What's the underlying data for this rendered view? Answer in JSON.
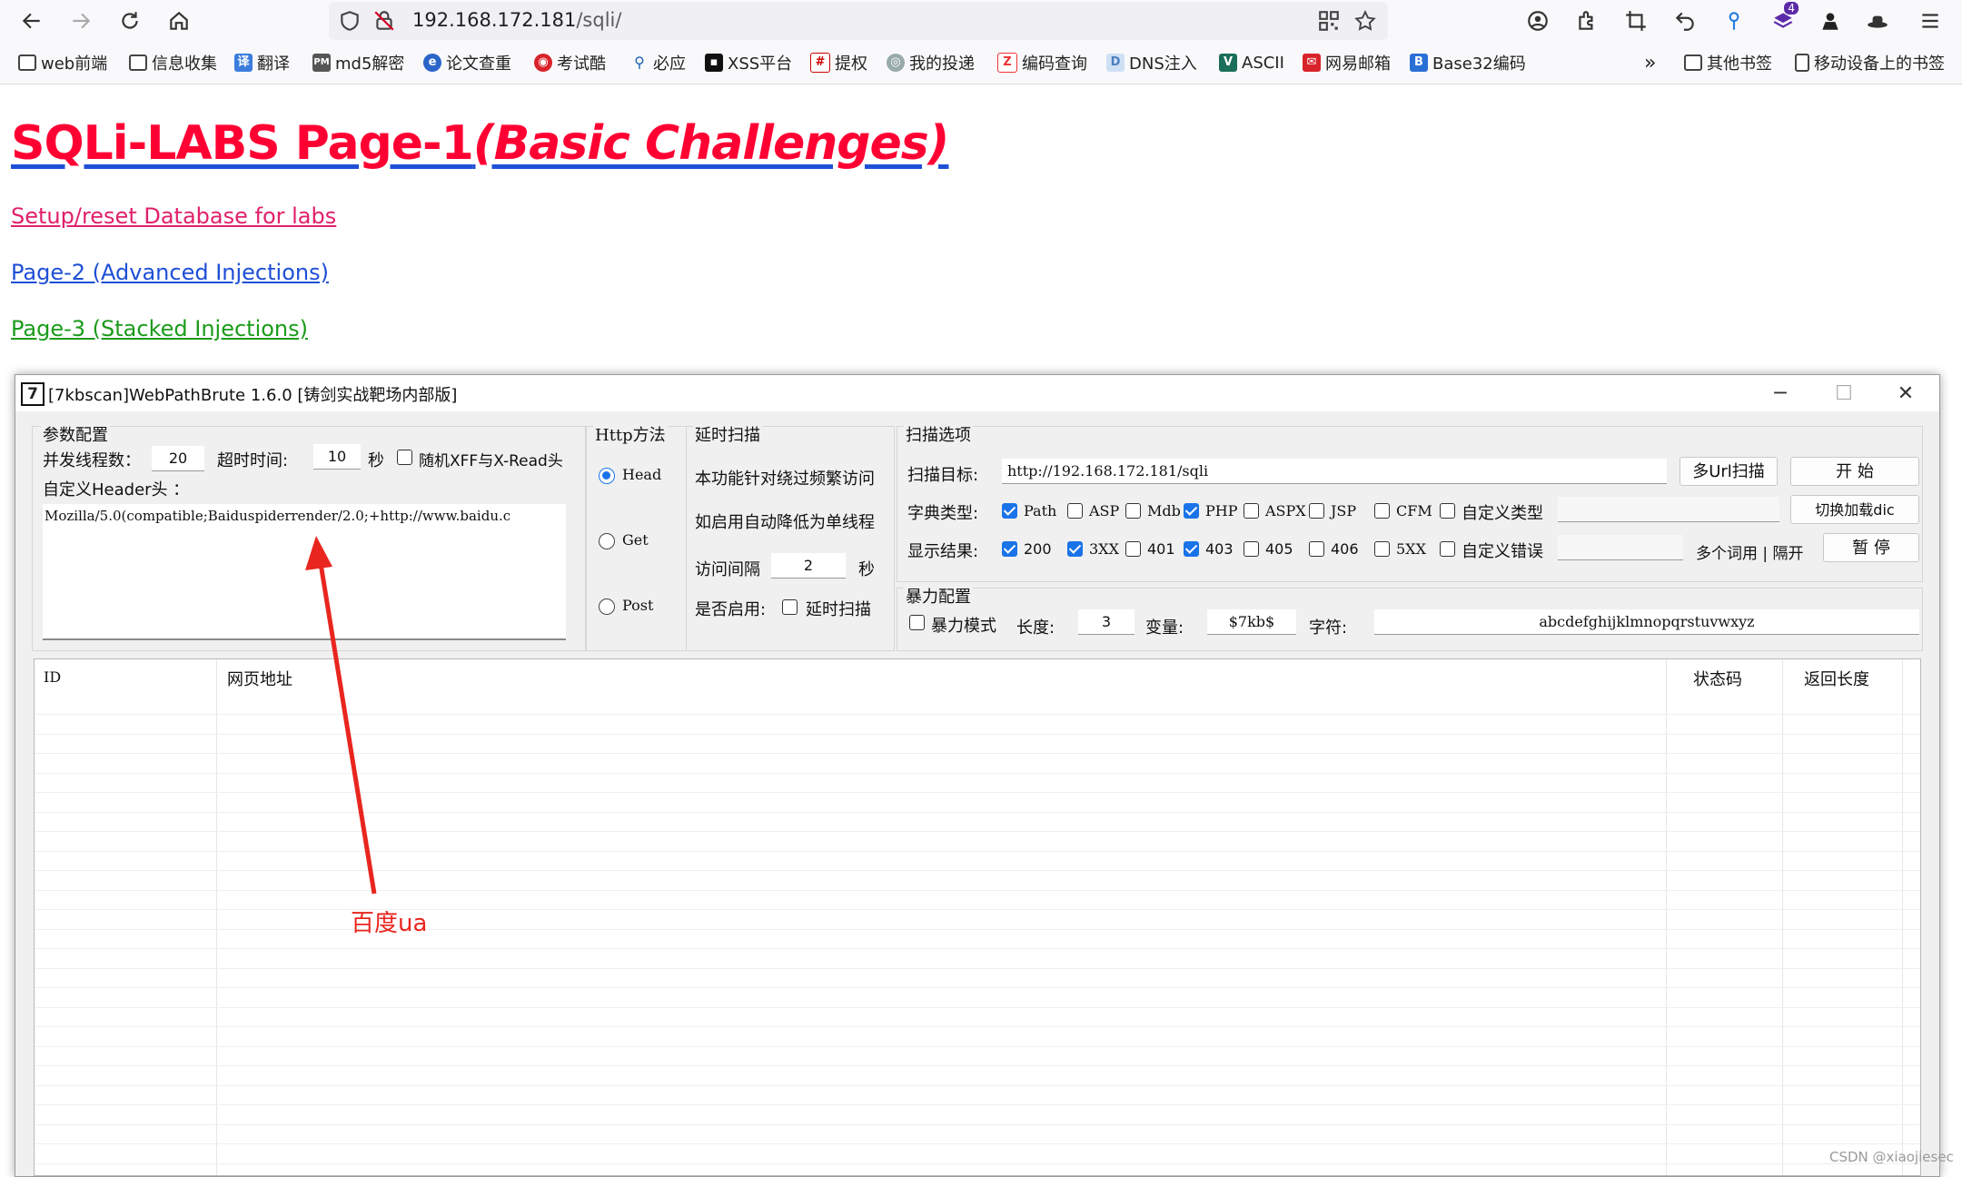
{
  "browser": {
    "url_host": "192.168.172.181",
    "url_path": "/sqli/",
    "bookmarks": [
      "web前端",
      "信息收集",
      "翻译",
      "md5解密",
      "论文查重",
      "考试酷",
      "必应",
      "XSS平台",
      "提权",
      "我的投递",
      "编码查询",
      "DNS注入",
      "ASCII",
      "网易邮箱",
      "Base32编码"
    ],
    "bookmarks_right": [
      "其他书签",
      "移动设备上的书签"
    ],
    "extension_badge": "4"
  },
  "page": {
    "title_main": "SQLi-LABS Page-1",
    "title_italic": "(Basic Challenges)",
    "link_setup": "Setup/reset Database for labs",
    "link_page2": "Page-2 (Advanced Injections)",
    "link_page3": "Page-3 (Stacked Injections)"
  },
  "app": {
    "icon_text": "7",
    "title": "[7kbscan]WebPathBrute 1.6.0 [铸剑实战靶场内部版]",
    "params": {
      "group_label": "参数配置",
      "threads_label": "并发线程数：",
      "threads_value": "20",
      "timeout_label": "超时时间:",
      "timeout_value": "10",
      "timeout_unit": "秒",
      "random_xff_label": "随机XFF与X-Read头",
      "header_label": "自定义Header头 ：",
      "header_value": "Mozilla/5.0(compatible;Baiduspiderrender/2.0;+http://www.baidu.c"
    },
    "http_method": {
      "group_label": "Http方法",
      "options": [
        "Head",
        "Get",
        "Post"
      ],
      "selected": "Head"
    },
    "delay": {
      "group_label": "延时扫描",
      "desc1": "本功能针对绕过频繁访问",
      "desc2": "如启用自动降低为单线程",
      "interval_label": "访问间隔",
      "interval_value": "2",
      "interval_unit": "秒",
      "enable_label": "是否启用:",
      "enable_checkbox": "延时扫描"
    },
    "scan": {
      "group_label": "扫描选项",
      "target_label": "扫描目标:",
      "target_value": "http://192.168.172.181/sqli",
      "multi_url_button": "多Url扫描",
      "start_button": "开 始",
      "dict_label": "字典类型:",
      "dict_types": [
        {
          "label": "Path",
          "checked": true
        },
        {
          "label": "ASP",
          "checked": false
        },
        {
          "label": "Mdb",
          "checked": false
        },
        {
          "label": "PHP",
          "checked": true
        },
        {
          "label": "ASPX",
          "checked": false
        },
        {
          "label": "JSP",
          "checked": false
        },
        {
          "label": "CFM",
          "checked": false
        },
        {
          "label": "自定义类型",
          "checked": false
        }
      ],
      "switch_dict_button": "切换加载dic",
      "show_label": "显示结果:",
      "results": [
        {
          "label": "200",
          "checked": true
        },
        {
          "label": "3XX",
          "checked": true
        },
        {
          "label": "401",
          "checked": false
        },
        {
          "label": "403",
          "checked": true
        },
        {
          "label": "405",
          "checked": false
        },
        {
          "label": "406",
          "checked": false
        },
        {
          "label": "5XX",
          "checked": false
        },
        {
          "label": "自定义错误",
          "checked": false
        }
      ],
      "multi_word_label": "多个词用 | 隔开",
      "pause_button": "暂 停"
    },
    "brute": {
      "group_label": "暴力配置",
      "mode_label": "暴力模式",
      "length_label": "长度:",
      "length_value": "3",
      "var_label": "变量:",
      "var_value": "$7kb$",
      "chars_label": "字符:",
      "chars_value": "abcdefghijklmnopqrstuvwxyz"
    },
    "list": {
      "columns": [
        "ID",
        "网页地址",
        "状态码",
        "返回长度"
      ]
    }
  },
  "annotation": {
    "text": "百度ua",
    "color": "#e8261f"
  },
  "watermark": "CSDN @xiaojiesec"
}
